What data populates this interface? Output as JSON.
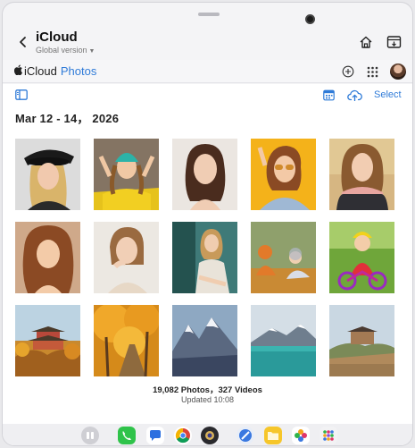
{
  "app": {
    "title": "iCloud",
    "subtitle": "Global version"
  },
  "icloud_bar": {
    "brand_icloud": "iCloud",
    "brand_photos": "Photos"
  },
  "toolbar": {
    "select_label": "Select"
  },
  "library": {
    "date_range": "Mar 12 - 14， 2026",
    "summary": "19,082 Photos，327 Videos",
    "updated": "Updated 10:08"
  },
  "photos": [
    {
      "name": "photo-woman-black-hat",
      "subject": "portrait"
    },
    {
      "name": "photo-woman-teal-beanie",
      "subject": "portrait"
    },
    {
      "name": "photo-woman-dark-hair",
      "subject": "portrait"
    },
    {
      "name": "photo-woman-sunglasses-yellow",
      "subject": "portrait"
    },
    {
      "name": "photo-woman-scarf",
      "subject": "portrait"
    },
    {
      "name": "photo-woman-curly-hair",
      "subject": "portrait"
    },
    {
      "name": "photo-woman-hand-on-chin",
      "subject": "portrait"
    },
    {
      "name": "photo-woman-sitting",
      "subject": "portrait"
    },
    {
      "name": "photo-children-autumn",
      "subject": "children"
    },
    {
      "name": "photo-child-bicycle",
      "subject": "children"
    },
    {
      "name": "photo-pagoda-autumn",
      "subject": "landscape"
    },
    {
      "name": "photo-autumn-trees",
      "subject": "landscape"
    },
    {
      "name": "photo-snowy-mountains",
      "subject": "landscape"
    },
    {
      "name": "photo-mountain-lake",
      "subject": "landscape"
    },
    {
      "name": "photo-great-wall",
      "subject": "landscape"
    }
  ],
  "dock_apps": [
    "multitask-icon",
    "phone-icon",
    "messages-icon",
    "chrome-icon",
    "camera-app-icon",
    "browser-icon",
    "files-icon",
    "photos-app-icon",
    "app-drawer-icon"
  ],
  "colors": {
    "accent": "#2f7bd8",
    "background": "#ffffff"
  }
}
